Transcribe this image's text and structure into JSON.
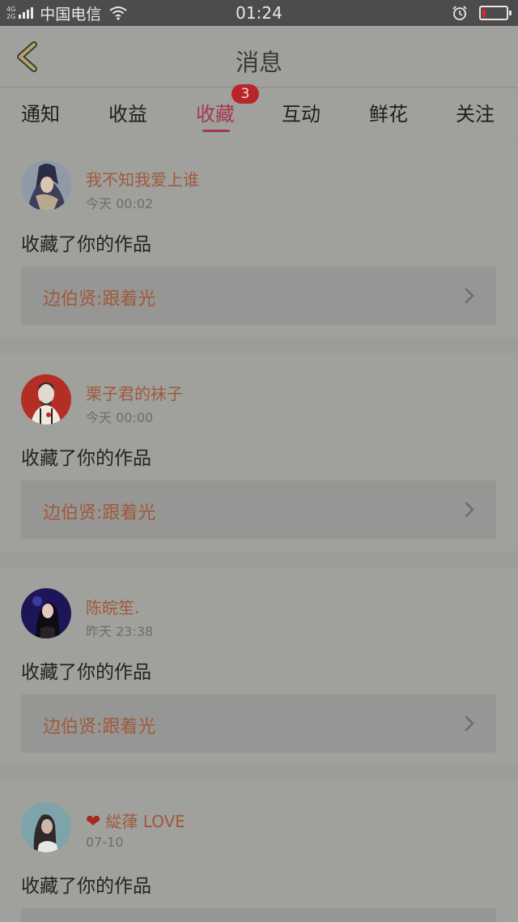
{
  "status_bar": {
    "network_top": "4G",
    "network_bottom": "2G",
    "carrier": "中国电信",
    "time": "01:24",
    "battery_level": 0.12
  },
  "header": {
    "title": "消息",
    "back_icon": "chevron-left-icon"
  },
  "tabs": {
    "items": [
      "通知",
      "收益",
      "收藏",
      "互动",
      "鲜花",
      "关注"
    ],
    "active_index": 2,
    "badge": "3"
  },
  "feed": [
    {
      "name": "我不知我爱上谁",
      "time": "今天 00:02",
      "text": "收藏了你的作品",
      "work": "边伯贤:跟着光"
    },
    {
      "name": "栗子君的袜子",
      "time": "今天 00:00",
      "text": "收藏了你的作品",
      "work": "边伯贤:跟着光"
    },
    {
      "name": "陈皖笙.",
      "time": "昨天 23:38",
      "text": "收藏了你的作品",
      "work": "边伯贤:跟着光"
    },
    {
      "name": "緃葎 LOVE",
      "time": "07-10",
      "text": "收藏了你的作品",
      "work": ""
    }
  ],
  "colors": {
    "accent": "#a5384d",
    "badge": "#b8262a",
    "link": "#9e5a3c"
  }
}
